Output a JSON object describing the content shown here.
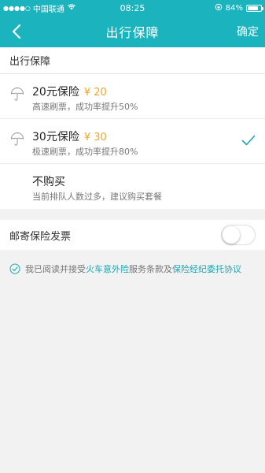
{
  "status_bar": {
    "signal": "●●●●○",
    "carrier": "中国联通",
    "time": "08:25",
    "battery": "84%",
    "battery_level": 0.84
  },
  "nav": {
    "title": "出行保障",
    "confirm_label": "确定"
  },
  "section": {
    "title": "出行保障"
  },
  "options": [
    {
      "title": "20元保险",
      "price": "¥ 20",
      "desc": "高速刷票，成功率提升50%",
      "selected": false,
      "icon": "umbrella-icon"
    },
    {
      "title": "30元保险",
      "price": "¥ 30",
      "desc": "极速刷票，成功率提升80%",
      "selected": true,
      "icon": "umbrella-icon"
    },
    {
      "title": "不购买",
      "price": "",
      "desc": "当前排队人数过多，建议购买套餐",
      "selected": false,
      "icon": ""
    }
  ],
  "mail": {
    "label": "邮寄保险发票",
    "toggle_on": false
  },
  "agreement": {
    "prefix": "我已阅读并接受",
    "link1": "火车意外险",
    "middle": "服务条款及",
    "link2": "保险经纪委托协议"
  },
  "colors": {
    "accent": "#1bb3bd",
    "price": "#f5a623",
    "link": "#1aa8b3"
  }
}
